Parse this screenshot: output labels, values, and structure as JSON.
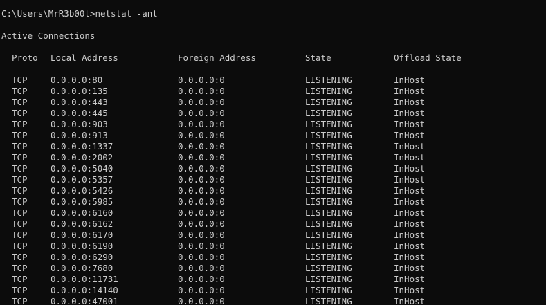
{
  "console": {
    "command_line": "C:\\Users\\MrR3b00t>netstat -ant",
    "section_title": "Active Connections",
    "columns": {
      "proto": "Proto",
      "local": "Local Address",
      "foreign": "Foreign Address",
      "state": "State",
      "offload": "Offload State"
    },
    "rows": [
      {
        "proto": "TCP",
        "local": "0.0.0.0:80",
        "foreign": "0.0.0.0:0",
        "state": "LISTENING",
        "offload": "InHost"
      },
      {
        "proto": "TCP",
        "local": "0.0.0.0:135",
        "foreign": "0.0.0.0:0",
        "state": "LISTENING",
        "offload": "InHost"
      },
      {
        "proto": "TCP",
        "local": "0.0.0.0:443",
        "foreign": "0.0.0.0:0",
        "state": "LISTENING",
        "offload": "InHost"
      },
      {
        "proto": "TCP",
        "local": "0.0.0.0:445",
        "foreign": "0.0.0.0:0",
        "state": "LISTENING",
        "offload": "InHost"
      },
      {
        "proto": "TCP",
        "local": "0.0.0.0:903",
        "foreign": "0.0.0.0:0",
        "state": "LISTENING",
        "offload": "InHost"
      },
      {
        "proto": "TCP",
        "local": "0.0.0.0:913",
        "foreign": "0.0.0.0:0",
        "state": "LISTENING",
        "offload": "InHost"
      },
      {
        "proto": "TCP",
        "local": "0.0.0.0:1337",
        "foreign": "0.0.0.0:0",
        "state": "LISTENING",
        "offload": "InHost"
      },
      {
        "proto": "TCP",
        "local": "0.0.0.0:2002",
        "foreign": "0.0.0.0:0",
        "state": "LISTENING",
        "offload": "InHost"
      },
      {
        "proto": "TCP",
        "local": "0.0.0.0:5040",
        "foreign": "0.0.0.0:0",
        "state": "LISTENING",
        "offload": "InHost"
      },
      {
        "proto": "TCP",
        "local": "0.0.0.0:5357",
        "foreign": "0.0.0.0:0",
        "state": "LISTENING",
        "offload": "InHost"
      },
      {
        "proto": "TCP",
        "local": "0.0.0.0:5426",
        "foreign": "0.0.0.0:0",
        "state": "LISTENING",
        "offload": "InHost"
      },
      {
        "proto": "TCP",
        "local": "0.0.0.0:5985",
        "foreign": "0.0.0.0:0",
        "state": "LISTENING",
        "offload": "InHost"
      },
      {
        "proto": "TCP",
        "local": "0.0.0.0:6160",
        "foreign": "0.0.0.0:0",
        "state": "LISTENING",
        "offload": "InHost"
      },
      {
        "proto": "TCP",
        "local": "0.0.0.0:6162",
        "foreign": "0.0.0.0:0",
        "state": "LISTENING",
        "offload": "InHost"
      },
      {
        "proto": "TCP",
        "local": "0.0.0.0:6170",
        "foreign": "0.0.0.0:0",
        "state": "LISTENING",
        "offload": "InHost"
      },
      {
        "proto": "TCP",
        "local": "0.0.0.0:6190",
        "foreign": "0.0.0.0:0",
        "state": "LISTENING",
        "offload": "InHost"
      },
      {
        "proto": "TCP",
        "local": "0.0.0.0:6290",
        "foreign": "0.0.0.0:0",
        "state": "LISTENING",
        "offload": "InHost"
      },
      {
        "proto": "TCP",
        "local": "0.0.0.0:7680",
        "foreign": "0.0.0.0:0",
        "state": "LISTENING",
        "offload": "InHost"
      },
      {
        "proto": "TCP",
        "local": "0.0.0.0:11731",
        "foreign": "0.0.0.0:0",
        "state": "LISTENING",
        "offload": "InHost"
      },
      {
        "proto": "TCP",
        "local": "0.0.0.0:14140",
        "foreign": "0.0.0.0:0",
        "state": "LISTENING",
        "offload": "InHost"
      },
      {
        "proto": "TCP",
        "local": "0.0.0.0:47001",
        "foreign": "0.0.0.0:0",
        "state": "LISTENING",
        "offload": "InHost"
      }
    ]
  },
  "colors": {
    "background": "#0c0c0c",
    "text": "#cccccc"
  }
}
